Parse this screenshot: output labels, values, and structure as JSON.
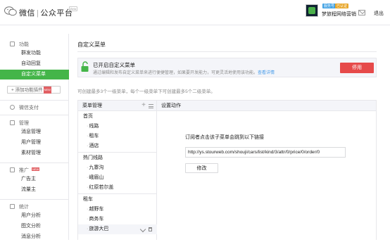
{
  "header": {
    "brand": "微信",
    "brand_sep": "|",
    "brand_sub": "公众平台",
    "brand_tag": "Beta",
    "account_badges": [
      "服务号",
      "已认证"
    ],
    "account_name": "梦旅程网络营销",
    "logout_label": "退出"
  },
  "sidebar": {
    "sections": [
      {
        "title": "功能",
        "icon": "grid-icon"
      },
      {
        "title": "微信支付",
        "icon": "wallet-icon"
      },
      {
        "title": "管理",
        "icon": "manage-icon"
      },
      {
        "title": "推广",
        "icon": "megaphone-icon",
        "new": "NEW"
      },
      {
        "title": "统计",
        "icon": "chart-icon"
      }
    ],
    "items": [
      {
        "label": "群发功能"
      },
      {
        "label": "自动回复"
      },
      {
        "label": "自定义菜单",
        "active": true
      },
      {
        "label": "消息管理"
      },
      {
        "label": "用户管理"
      },
      {
        "label": "素材管理"
      },
      {
        "label": "广告主"
      },
      {
        "label": "流量主"
      },
      {
        "label": "用户分析"
      },
      {
        "label": "图文分析"
      },
      {
        "label": "消息分析"
      }
    ],
    "add_plugin": {
      "label": "+ 添加功能插件",
      "new": "NEW"
    }
  },
  "main": {
    "title": "自定义菜单",
    "notice": {
      "title": "已开启自定义菜单",
      "desc": "通过编辑和发布自定义菜单来进行便捷管理，如果要开发能力，可更灵活地使用该功能。",
      "link": "查看详情",
      "button": "停用"
    },
    "tip": "可创建最多3个一级菜单，每个一级菜单下可创建最多5个二级菜单。",
    "menu_panel": {
      "header": "菜单管理",
      "groups": [
        {
          "label": "首页",
          "children": [
            "线路",
            "租车",
            "酒店"
          ]
        },
        {
          "label": "热门线路",
          "children": [
            "九寨沟",
            "峨眉山",
            "红原若尔盖"
          ]
        },
        {
          "label": "租车",
          "children": [
            "越野车",
            "商务车",
            "旅游大巴"
          ]
        }
      ],
      "selected": "旅游大巴"
    },
    "settings_panel": {
      "header": "设置动作",
      "label": "订阅者点击该子菜单会跳到以下链接",
      "url": "http://ys.stourweb.com/shouji/cars/list/kind/3/attr/0/price/0/order/0",
      "button": "修改"
    }
  },
  "colors": {
    "accent": "#44b549",
    "danger": "#e64a4a",
    "link": "#459ae9",
    "panel_bg": "#f4f5f9",
    "border": "#e7e7eb"
  }
}
